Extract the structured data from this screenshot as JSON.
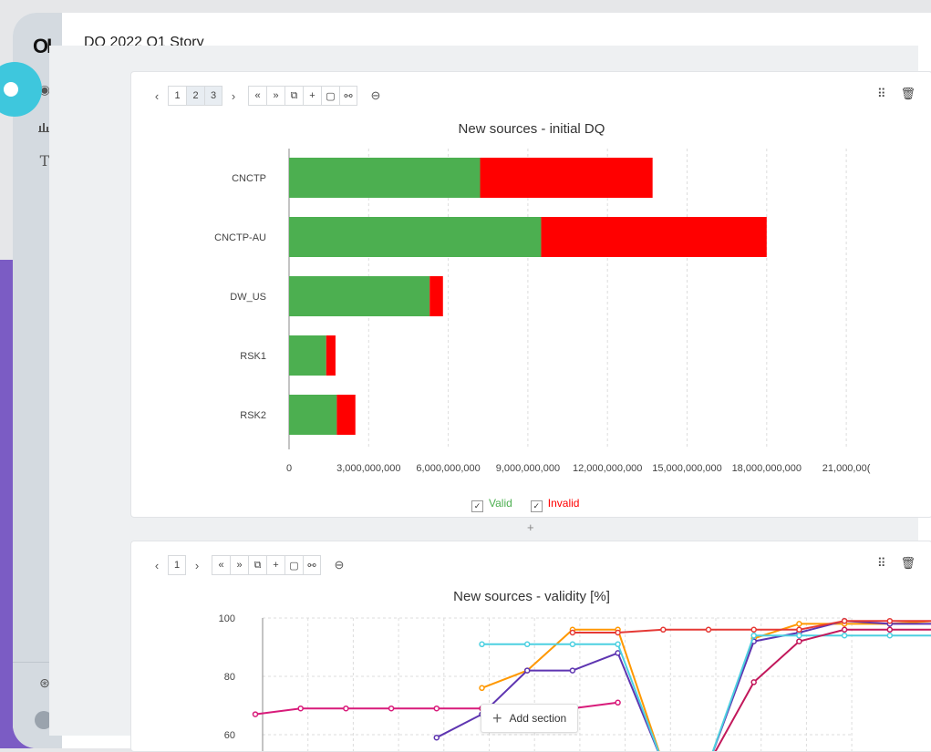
{
  "app": {
    "title": "DQ 2022 Q1 Story",
    "logo": "OI"
  },
  "sidebar": {
    "icons": [
      "globe-icon",
      "bar-chart-icon",
      "text-icon",
      "help-icon",
      "user-avatar-icon"
    ]
  },
  "card1": {
    "pages": [
      "1",
      "2",
      "3"
    ],
    "chart_title": "New sources - initial DQ",
    "legend": [
      {
        "label": "Valid",
        "color": "#4caf50"
      },
      {
        "label": "Invalid",
        "color": "#ff0000"
      }
    ]
  },
  "card2": {
    "pages": [
      "1"
    ],
    "chart_title": "New sources - validity [%]"
  },
  "add_section": {
    "label": "Add section"
  },
  "chart_data": [
    {
      "type": "bar",
      "orientation": "horizontal",
      "stacked": true,
      "title": "New sources - initial DQ",
      "categories": [
        "CNCTP",
        "CNCTP-AU",
        "DW_US",
        "RSK1",
        "RSK2"
      ],
      "series": [
        {
          "name": "Valid",
          "color": "#4caf50",
          "values": [
            7200000000,
            9500000000,
            5300000000,
            1400000000,
            1800000000
          ]
        },
        {
          "name": "Invalid",
          "color": "#ff0000",
          "values": [
            6500000000,
            8500000000,
            500000000,
            350000000,
            700000000
          ]
        }
      ],
      "xticks": [
        "0",
        "3,000,000,000",
        "6,000,000,000",
        "9,000,000,000",
        "12,000,000,000",
        "15,000,000,000",
        "18,000,000,000",
        "21,000,00("
      ],
      "xlim": [
        0,
        21000000000
      ],
      "legend": "bottom",
      "grid": true
    },
    {
      "type": "line",
      "title": "New sources - validity [%]",
      "yticks": [
        "100",
        "80",
        "60"
      ],
      "ylim": [
        55,
        100
      ],
      "grid": true,
      "series": [
        {
          "color": "#d81b7a",
          "points": [
            [
              0,
              67
            ],
            [
              1,
              69
            ],
            [
              2,
              69
            ],
            [
              3,
              69
            ],
            [
              4,
              69
            ],
            [
              5,
              69
            ],
            [
              6,
              69
            ],
            [
              7,
              69
            ],
            [
              8,
              71
            ]
          ]
        },
        {
          "color": "#ff9800",
          "points": [
            [
              5,
              76
            ],
            [
              6,
              82
            ],
            [
              7,
              96
            ],
            [
              8,
              96
            ],
            [
              9,
              50
            ],
            [
              10,
              50
            ],
            [
              11,
              93
            ],
            [
              12,
              98
            ],
            [
              13,
              98
            ],
            [
              14,
              98
            ],
            [
              15,
              99
            ]
          ]
        },
        {
          "color": "#5e35b1",
          "points": [
            [
              4,
              59
            ],
            [
              5,
              67
            ],
            [
              6,
              82
            ],
            [
              7,
              82
            ],
            [
              8,
              88
            ],
            [
              9,
              50
            ],
            [
              10,
              50
            ],
            [
              11,
              92
            ],
            [
              12,
              95
            ],
            [
              13,
              99
            ],
            [
              14,
              98
            ],
            [
              15,
              98
            ]
          ]
        },
        {
          "color": "#4dd0e1",
          "points": [
            [
              5,
              91
            ],
            [
              6,
              91
            ],
            [
              7,
              91
            ],
            [
              8,
              91
            ],
            [
              9,
              50
            ],
            [
              10,
              50
            ],
            [
              11,
              94
            ],
            [
              12,
              94
            ],
            [
              13,
              94
            ],
            [
              14,
              94
            ],
            [
              15,
              94
            ]
          ]
        },
        {
          "color": "#e53935",
          "points": [
            [
              7,
              95
            ],
            [
              8,
              95
            ],
            [
              9,
              96
            ],
            [
              10,
              96
            ],
            [
              11,
              96
            ],
            [
              12,
              96
            ],
            [
              13,
              99
            ],
            [
              14,
              99
            ],
            [
              15,
              99
            ]
          ]
        },
        {
          "color": "#c2185b",
          "points": [
            [
              9,
              50
            ],
            [
              10,
              50
            ],
            [
              11,
              78
            ],
            [
              12,
              92
            ],
            [
              13,
              96
            ],
            [
              14,
              96
            ],
            [
              15,
              96
            ]
          ]
        }
      ]
    }
  ]
}
